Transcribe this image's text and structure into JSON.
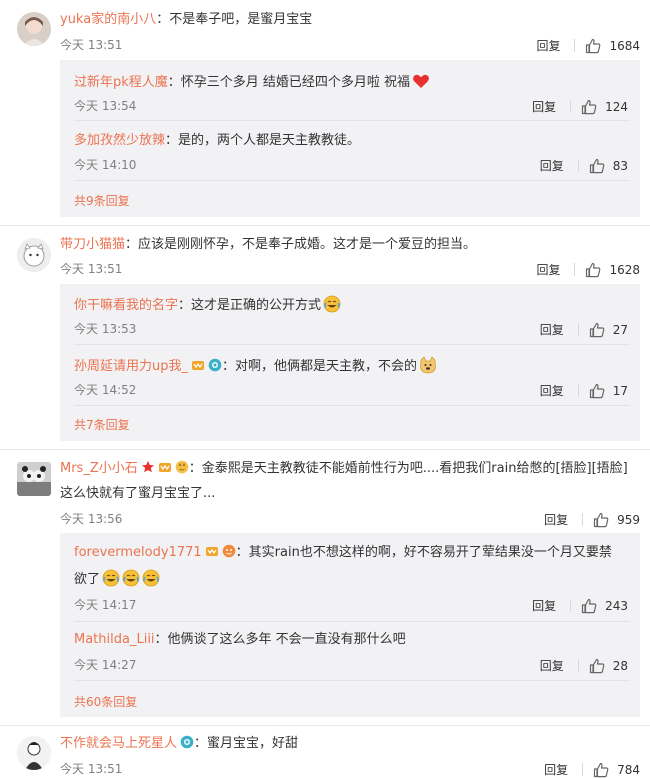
{
  "actions": {
    "reply": "回复"
  },
  "comments": [
    {
      "user": "yuka家的南小八",
      "text": "：不是奉子吧，是蜜月宝宝",
      "time": "今天 13:51",
      "likes": "1684",
      "replies": [
        {
          "user": "过新年pk程人魔",
          "text": "：怀孕三个多月 结婚已经四个多月啦 祝福",
          "time": "今天 13:54",
          "likes": "124",
          "emoji": "heart-emoji"
        },
        {
          "user": "多加孜然少放辣",
          "text": "：是的，两个人都是天主教教徒。",
          "time": "今天 14:10",
          "likes": "83"
        }
      ],
      "more": "共9条回复"
    },
    {
      "user": "带刀小猫猫",
      "text": "：应该是刚刚怀孕，不是奉子成婚。这才是一个爱豆的担当。",
      "time": "今天 13:51",
      "likes": "1628",
      "replies": [
        {
          "user": "你干嘛看我的名字",
          "text": "：这才是正确的公开方式",
          "time": "今天 13:53",
          "likes": "27",
          "emoji": "laugh-cry-emoji"
        },
        {
          "user": "孙周延请用力up我_",
          "text": "：对啊，他俩都是天主教，不会的",
          "time": "今天 14:52",
          "likes": "17",
          "emoji": "doge-emoji"
        }
      ],
      "more": "共7条回复"
    },
    {
      "user": "Mrs_Z小小石",
      "text": "：金泰熙是天主教教徒不能婚前性行为吧....看把我们rain给憋的[捂脸][捂脸]",
      "text2": "这么快就有了蜜月宝宝了...",
      "time": "今天 13:56",
      "likes": "959",
      "replies": [
        {
          "user": "forevermelody1771",
          "text": "：其实rain也不想这样的啊，好不容易开了荤结果没一个月又要禁",
          "text2": "欲了",
          "time": "今天 14:17",
          "likes": "243"
        },
        {
          "user": "Mathilda_Liii",
          "text": "：他俩谈了这么多年 不会一直没有那什么吧",
          "time": "今天 14:27",
          "likes": "28"
        }
      ],
      "more": "共60条回复"
    },
    {
      "user": "不作就会马上死星人",
      "text": "：蜜月宝宝，好甜",
      "time": "今天 13:51",
      "likes": "784"
    }
  ]
}
